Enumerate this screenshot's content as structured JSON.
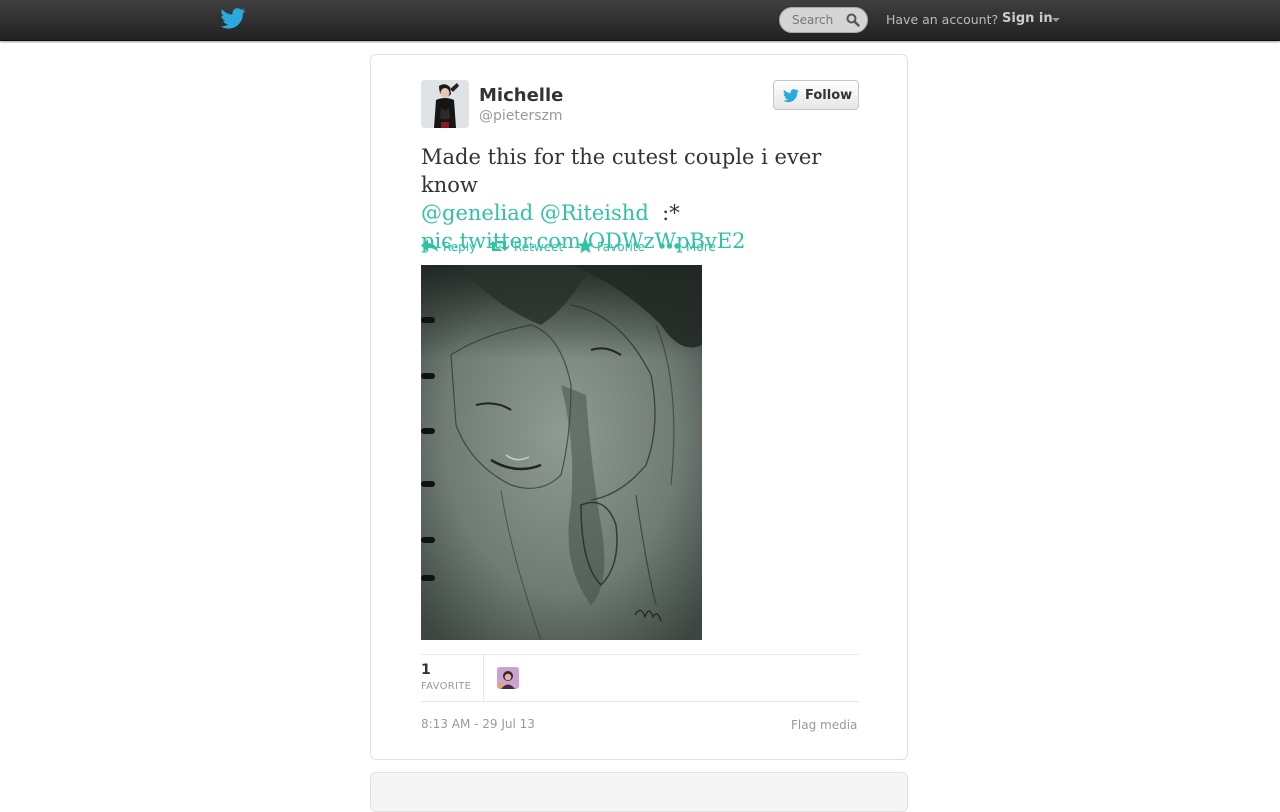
{
  "topbar": {
    "logo_icon": "twitter-bird-icon",
    "search": {
      "placeholder": "Search",
      "value": ""
    },
    "have_account_text": "Have an account?",
    "signin_label": "Sign in"
  },
  "tweet": {
    "author": {
      "fullname": "Michelle",
      "username": "@pieterszm"
    },
    "follow_label": "Follow",
    "text": {
      "line1": "Made this for the cutest couple i ever know",
      "mention1": "@geneliad",
      "mention2": "@Riteishd",
      "emoticon": ":*",
      "pic_link": "pic.twitter.com/ODWzWpBvE2"
    },
    "actions": {
      "reply": "Reply",
      "retweet": "Retweet",
      "favorite": "Favorite",
      "more": "More"
    },
    "stats": {
      "favorites_count": "1",
      "favorites_label": "FAVORITE"
    },
    "timestamp": "8:13 AM - 29 Jul 13",
    "flag_media": "Flag media"
  },
  "colors": {
    "topbar": "#2b2b2b",
    "link": "#2fc2a3",
    "twitter_blue": "#2aa9e0"
  }
}
